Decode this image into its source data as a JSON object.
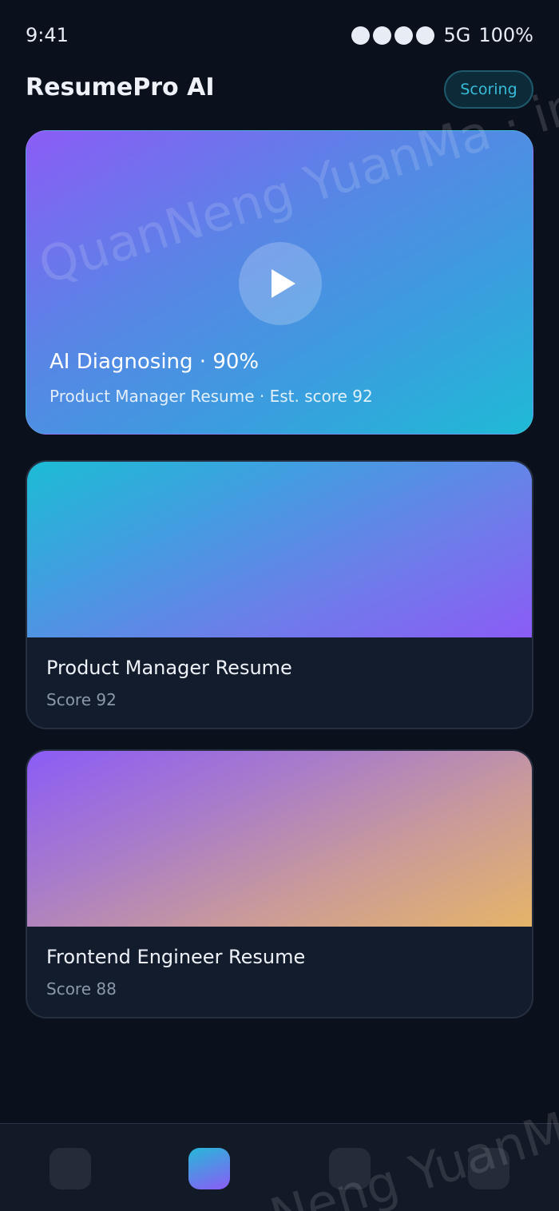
{
  "status_bar": {
    "time": "9:41",
    "signal_dots": 4,
    "network": "5G",
    "battery": "100%"
  },
  "header": {
    "title": "ResumePro AI",
    "badge": "Scoring"
  },
  "hero": {
    "status": "AI Diagnosing · 90%",
    "subtitle": "Product Manager Resume · Est. score 92",
    "progress": 0.9
  },
  "resumes": [
    {
      "title": "Product Manager Resume",
      "score": "Score 92"
    },
    {
      "title": "Frontend Engineer Resume",
      "score": "Score 88"
    }
  ],
  "watermark": {
    "top": "QuanNeng YuanMa · im",
    "bottom": "Neng YuanMa"
  },
  "colors": {
    "background": "#0b111c",
    "accent": "#38bcd9",
    "card": "#131c2c",
    "muted_text": "#8b97aa"
  },
  "nav": {
    "active_index": 1,
    "icons": [
      "home-tab-icon",
      "scoring-tab-icon",
      "templates-tab-icon",
      "profile-tab-icon"
    ]
  }
}
